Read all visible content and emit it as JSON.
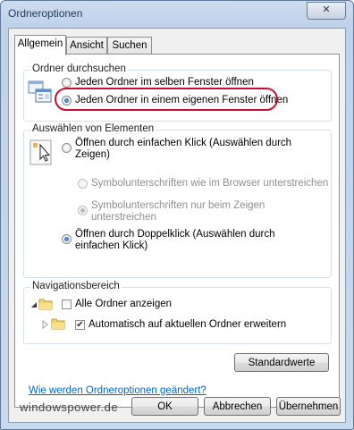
{
  "window": {
    "title": "Ordneroptionen",
    "close_glyph": "✕"
  },
  "tabs": [
    {
      "label": "Allgemein",
      "active": true
    },
    {
      "label": "Ansicht",
      "active": false
    },
    {
      "label": "Suchen",
      "active": false
    }
  ],
  "browse_folders": {
    "title": "Ordner durchsuchen",
    "options": [
      {
        "label": "Jeden Ordner im selben Fenster öffnen",
        "checked": false
      },
      {
        "label": "Jeden Ordner in einem eigenen Fenster öffnen",
        "checked": true
      }
    ],
    "highlight_color": "#c8102e"
  },
  "click_items": {
    "title": "Auswählen von Elementen",
    "single_click": "Öffnen durch einfachen Klick (Auswählen durch Zeigen)",
    "underline_browser": "Symbolunterschriften wie im Browser unterstreichen",
    "underline_hover": "Symbolunterschriften nur beim Zeigen unterstreichen",
    "double_click": "Öffnen durch Doppelklick (Auswählen durch einfachen Klick)"
  },
  "navigation_pane": {
    "title": "Navigationsbereich",
    "show_all_folders": {
      "label": "Alle Ordner anzeigen",
      "checked": false
    },
    "auto_expand": {
      "label": "Automatisch auf aktuellen Ordner erweitern",
      "checked": true
    }
  },
  "restore_defaults_label": "Standardwerte",
  "help_link": "Wie werden Ordneroptionen geändert?",
  "watermark": "windowspower.de",
  "buttons": {
    "ok": "OK",
    "cancel": "Abbrechen",
    "apply": "Übernehmen"
  },
  "check_glyph": "✔"
}
